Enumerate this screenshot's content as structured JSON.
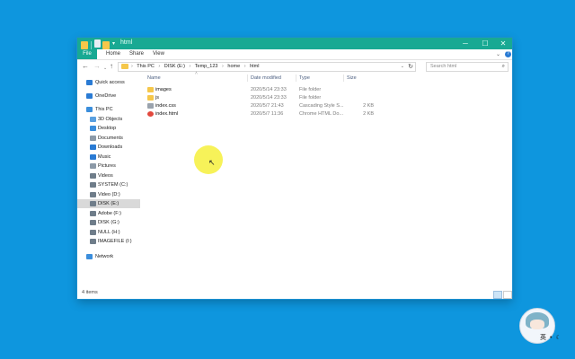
{
  "window": {
    "title": "html",
    "controls": {
      "minimize": "─",
      "maximize": "☐",
      "close": "✕"
    }
  },
  "ribbon": {
    "tabs": [
      "File",
      "Home",
      "Share",
      "View"
    ],
    "chevron": "⌄",
    "help": "?"
  },
  "navigation": {
    "back": "←",
    "forward": "→",
    "recent": "⌄",
    "up": "↑",
    "breadcrumbs": [
      "This PC",
      "DISK (E:)",
      "Temp_123",
      "home",
      "html"
    ],
    "breadcrumb_separator": "›",
    "dropdown": "⌄",
    "refresh": "↻",
    "search_placeholder": "Search html",
    "search_icon": "⌕"
  },
  "sidebar": {
    "items": [
      {
        "label": "Quick access",
        "icon": "star-icon",
        "color": "#2a7bd4"
      },
      {
        "label": "OneDrive",
        "icon": "cloud-icon",
        "color": "#2a7bd4"
      },
      {
        "label": "This PC",
        "icon": "computer-icon",
        "color": "#3b8edc"
      },
      {
        "label": "3D Objects",
        "icon": "cube-icon",
        "color": "#5aa0e0"
      },
      {
        "label": "Desktop",
        "icon": "desktop-icon",
        "color": "#3b8edc"
      },
      {
        "label": "Documents",
        "icon": "document-icon",
        "color": "#8c9aa8"
      },
      {
        "label": "Downloads",
        "icon": "download-icon",
        "color": "#2a7bd4"
      },
      {
        "label": "Music",
        "icon": "music-icon",
        "color": "#2a7bd4"
      },
      {
        "label": "Pictures",
        "icon": "pictures-icon",
        "color": "#8c9aa8"
      },
      {
        "label": "Videos",
        "icon": "videos-icon",
        "color": "#6f7d8a"
      },
      {
        "label": "SYSTEM (C:)",
        "icon": "drive-icon",
        "color": "#6f7d8a"
      },
      {
        "label": "Video (D:)",
        "icon": "drive-icon",
        "color": "#6f7d8a"
      },
      {
        "label": "DISK (E:)",
        "icon": "drive-icon",
        "color": "#6f7d8a"
      },
      {
        "label": "Adobe (F:)",
        "icon": "drive-icon",
        "color": "#6f7d8a"
      },
      {
        "label": "DISK (G:)",
        "icon": "drive-icon",
        "color": "#6f7d8a"
      },
      {
        "label": "NULL (H:)",
        "icon": "drive-icon",
        "color": "#6f7d8a"
      },
      {
        "label": "IMAGEFILE (I:)",
        "icon": "drive-icon",
        "color": "#6f7d8a"
      },
      {
        "label": "Network",
        "icon": "network-icon",
        "color": "#3b8edc"
      }
    ],
    "selected": "DISK (E:)"
  },
  "file_list": {
    "columns": [
      "Name",
      "Date modified",
      "Type",
      "Size"
    ],
    "rows": [
      {
        "name": "images",
        "date": "2020/5/14 23:33",
        "type": "File folder",
        "size": "",
        "icon": "folder-icon",
        "color": "#f5c74a"
      },
      {
        "name": "js",
        "date": "2020/5/14 23:33",
        "type": "File folder",
        "size": "",
        "icon": "folder-icon",
        "color": "#f5c74a"
      },
      {
        "name": "index.css",
        "date": "2020/5/7 21:43",
        "type": "Cascading Style S...",
        "size": "2 KB",
        "icon": "css-file-icon",
        "color": "#9aa3ad"
      },
      {
        "name": "index.html",
        "date": "2020/5/7 11:36",
        "type": "Chrome HTML Do...",
        "size": "2 KB",
        "icon": "chrome-icon",
        "color": "#e2483d"
      }
    ]
  },
  "status": {
    "items_count": "4 items"
  },
  "ime": {
    "language": "英",
    "punctuation": "•",
    "moon": "☾"
  },
  "colors": {
    "desktop": "#0e96de",
    "titlebar": "#18a993",
    "cursor_highlight": "#f6f03c"
  }
}
